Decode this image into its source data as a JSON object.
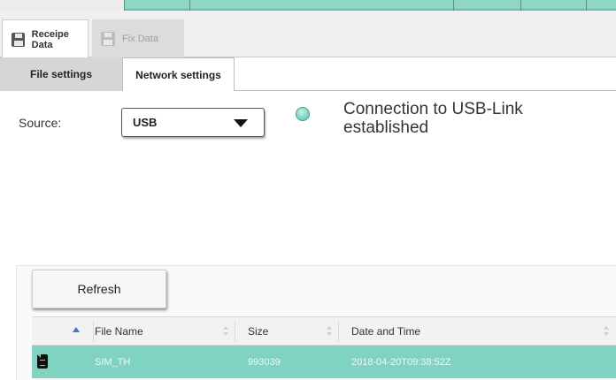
{
  "data_tabs": [
    {
      "label": "Receipe Data",
      "active": true
    },
    {
      "label": "Fix Data",
      "active": false
    }
  ],
  "settings_tabs": [
    {
      "label": "File settings",
      "active": false
    },
    {
      "label": "Network settings",
      "active": true
    }
  ],
  "source": {
    "label": "Source:",
    "selected": "USB"
  },
  "connection": {
    "status_text": "Connection to USB-Link established",
    "led_color": "#8fdcca"
  },
  "refresh_label": "Refresh",
  "table": {
    "columns": [
      "File Name",
      "Size",
      "Date and Time"
    ],
    "sorted_column": "File Name",
    "rows": [
      {
        "file_name": "SIM_TH",
        "size": "993039",
        "date_time": "2018-04-20T09:38:52Z",
        "selected": true
      }
    ]
  },
  "colors": {
    "accent": "#8ed6c6",
    "selected_row": "#7fd3c0"
  }
}
